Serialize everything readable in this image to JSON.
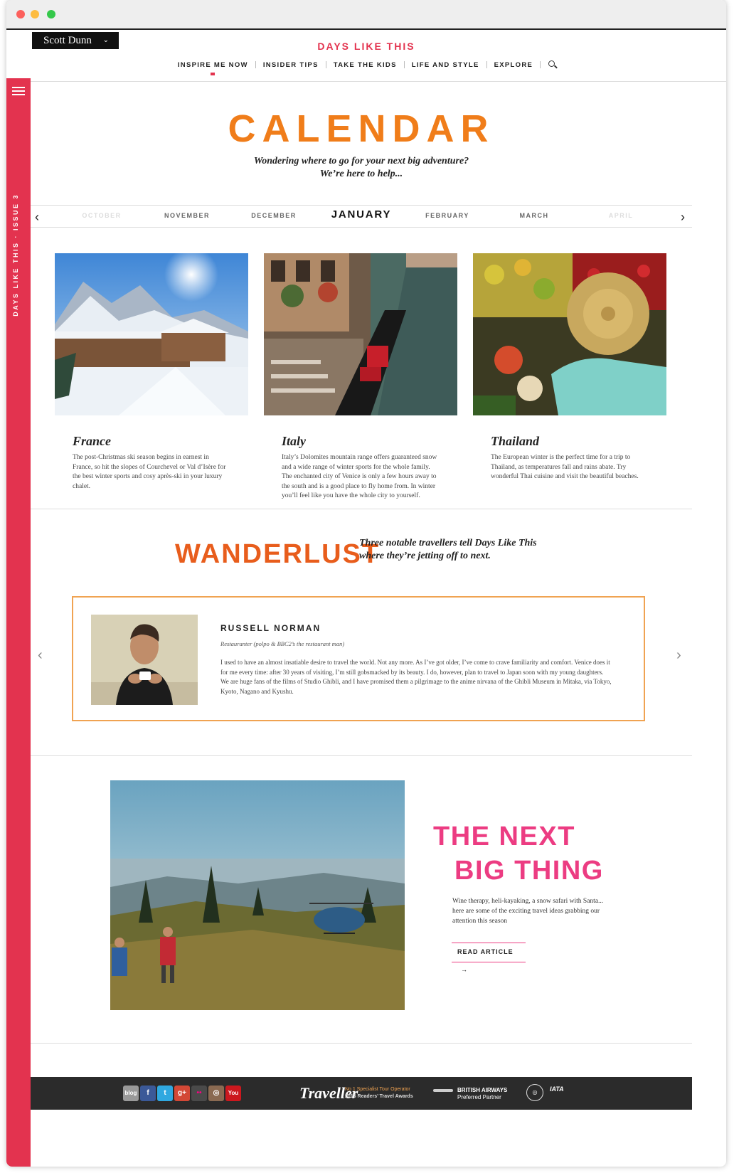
{
  "header": {
    "brand_label": "Scott Dunn",
    "brand_chevron": "⌄",
    "masthead": "DAYS LIKE THIS",
    "nav": [
      "INSPIRE ME NOW",
      "INSIDER TIPS",
      "TAKE THE KIDS",
      "LIFE AND STYLE",
      "EXPLORE"
    ],
    "nav_active": "INSPIRE ME NOW"
  },
  "sidebar": {
    "vertical_text": "DAYS LIKE THIS · ISSUE 3",
    "color": "#e3334f"
  },
  "calendar": {
    "title": "CALENDAR",
    "subtitle_line1": "Wondering where to go for your next big adventure?",
    "subtitle_line2": "We’re here to help...",
    "months": [
      "OCTOBER",
      "NOVEMBER",
      "DECEMBER",
      "JANUARY",
      "FEBRUARY",
      "MARCH",
      "APRIL"
    ],
    "current_month": "JANUARY",
    "prev_arrow": "‹",
    "next_arrow": "›"
  },
  "destinations": [
    {
      "title": "France",
      "text": "The post-Christmas ski season begins in earnest in France, so hit the slopes of Courchevel or Val d’Isère for the best winter sports and cosy après-ski in your luxury chalet."
    },
    {
      "title": "Italy",
      "text": "Italy’s Dolomites mountain range offers guaranteed snow and a wide range of winter sports for the whole family. The enchanted city of Venice is only a few hours away to the south and is a good place to fly home from. In winter you’ll feel like you have the whole city to yourself."
    },
    {
      "title": "Thailand",
      "text": "The European winter is the perfect time for a trip to Thailand, as temperatures fall and rains abate. Try wonderful Thai cuisine and visit the beautiful beaches."
    }
  ],
  "wanderlust": {
    "title": "WANDERLUST",
    "subtitle_line1": "Three notable travellers tell Days Like This",
    "subtitle_line2": "where they’re jetting off to next.",
    "name": "RUSSELL NORMAN",
    "role": "Restauranter (polpo & BBC2’s the restaurant man)",
    "quote": "I used to have an almost insatiable desire to travel the world. Not any more. As I’ve got older, I’ve come to crave familiarity and comfort. Venice does it for me every time: after 30 years of visiting, I’m still gobsmacked by its beauty. I do, however, plan to travel to Japan soon with my young daughters. We are huge fans of the films of Studio Ghibli, and I have promised them a pilgrimage to the anime nirvana of the Ghibli Museum in Mitaka, via Tokyo, Kyoto, Nagano and Kyushu.",
    "prev_arrow": "‹",
    "next_arrow": "›",
    "border_color": "#f0a352"
  },
  "next_big_thing": {
    "title_line1": "THE NEXT",
    "title_line2": "BIG THING",
    "text": "Wine therapy, heli-kayaking, a snow safari with Santa... here are some of the exciting travel ideas grabbing our attention this season",
    "button": "READ ARTICLE",
    "button_arrow": "→",
    "color": "#ec3c82"
  },
  "footer": {
    "socials": [
      {
        "icon": "blog-icon",
        "label": "blog",
        "color": "#999999"
      },
      {
        "icon": "facebook-icon",
        "label": "f",
        "color": "#3b5998"
      },
      {
        "icon": "twitter-icon",
        "label": "t",
        "color": "#2fa8e0"
      },
      {
        "icon": "googleplus-icon",
        "label": "g+",
        "color": "#d34836"
      },
      {
        "icon": "flickr-icon",
        "label": "••",
        "color": "#4a4a4a"
      },
      {
        "icon": "instagram-icon",
        "label": "◎",
        "color": "#8a6a52"
      },
      {
        "icon": "youtube-icon",
        "label": "You",
        "color": "#cc181e"
      }
    ],
    "traveller_logo": "Traveller",
    "award_line1": "No 1 Specialist Tour Operator",
    "award_line2": "2015 Readers’ Travel Awards",
    "ba_line1": "BRITISH AIRWAYS",
    "ba_line2": "Preferred Partner",
    "iata_label": "IATA"
  }
}
